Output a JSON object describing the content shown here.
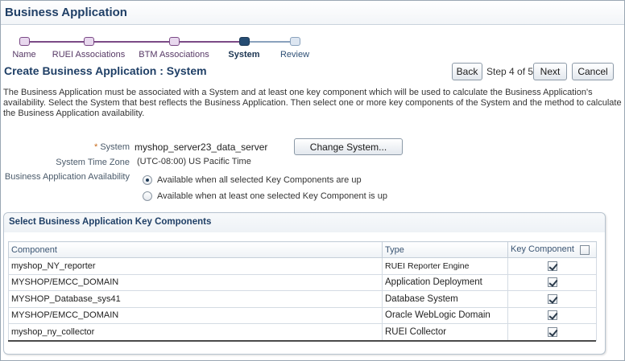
{
  "app": {
    "title": "Business Application"
  },
  "train": {
    "stops": [
      {
        "label": "Name",
        "state": "visited"
      },
      {
        "label": "RUEI Associations",
        "state": "visited"
      },
      {
        "label": "BTM Associations",
        "state": "visited"
      },
      {
        "label": "System",
        "state": "current"
      },
      {
        "label": "Review",
        "state": "future"
      }
    ]
  },
  "page": {
    "title": "Create Business Application : System"
  },
  "nav": {
    "back_label": "Back",
    "step_text": "Step 4 of 5",
    "next_label": "Next",
    "cancel_label": "Cancel"
  },
  "description": "The Business Application must be associated with a System and at least one key component which will be used to calculate the Business Application's availability. Select the System that best reflects the Business Application. Then select one or more key components of the System and the method to calculate the Business Application availability.",
  "form": {
    "system_required_mark": "*",
    "system_label": "System",
    "system_value": "myshop_server23_data_server",
    "change_system_label": "Change System...",
    "timezone_label": "System Time Zone",
    "timezone_value": "(UTC-08:00) US Pacific Time",
    "availability_label": "Business Application Availability",
    "availability_options": [
      {
        "label": "Available when all selected Key Components are up",
        "selected": true
      },
      {
        "label": "Available when at least one selected Key Component is up",
        "selected": false
      }
    ]
  },
  "components": {
    "section_title": "Select Business Application Key Components",
    "columns": {
      "component": "Component",
      "type": "Type",
      "key": "Key Component"
    },
    "header_checkbox_checked": false,
    "rows": [
      {
        "component": "myshop_NY_reporter",
        "type": "RUEI Reporter Engine",
        "key": true
      },
      {
        "component": "MYSHOP/EMCC_DOMAIN",
        "type": "Application Deployment",
        "key": true
      },
      {
        "component": "MYSHOP_Database_sys41",
        "type": "Database System",
        "key": true
      },
      {
        "component": "MYSHOP/EMCC_DOMAIN",
        "type": "Oracle WebLogic Domain",
        "key": true
      },
      {
        "component": "myshop_ny_collector",
        "type": "RUEI Collector",
        "key": true
      }
    ]
  }
}
